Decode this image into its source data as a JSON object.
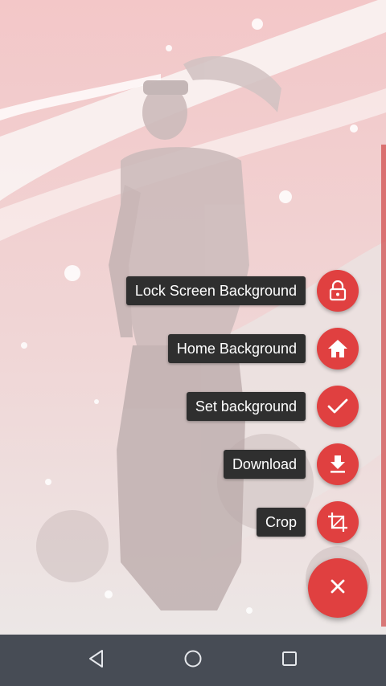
{
  "wallpaper": {
    "description_icon": "wallpaper-image",
    "tint_color": "#f2c5c5"
  },
  "fab_menu": {
    "accent_color": "#e04040",
    "items": [
      {
        "label": "Lock Screen Background",
        "icon": "lock-icon"
      },
      {
        "label": "Home Background",
        "icon": "home-icon"
      },
      {
        "label": "Set background",
        "icon": "check-icon"
      },
      {
        "label": "Download",
        "icon": "download-icon"
      },
      {
        "label": "Crop",
        "icon": "crop-icon"
      }
    ],
    "main_button_icon": "close-icon"
  },
  "nav_bar": {
    "color": "#474c55",
    "buttons": [
      "back-icon",
      "home-circle-icon",
      "recents-icon"
    ]
  }
}
